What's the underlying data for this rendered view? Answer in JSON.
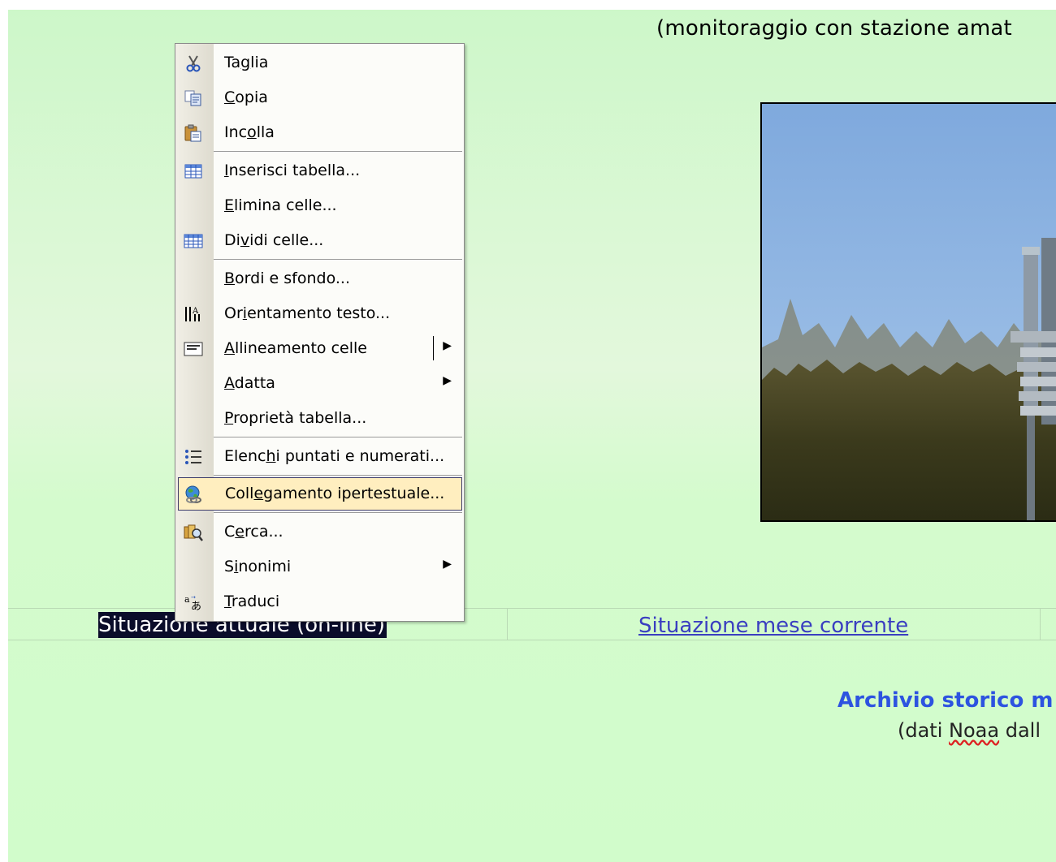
{
  "page": {
    "title_text": "(monitoraggio con stazione amat",
    "table_cells": {
      "current_situation": "Situazione attuale (on-line)",
      "current_month_link": "Situazione mese corrente"
    },
    "archive_heading": "Archivio storico m",
    "archive_sub_prefix": "(dati ",
    "archive_sub_noaa": "Noaa",
    "archive_sub_suffix": " dall",
    "colors": {
      "background": "#d1fccb",
      "link": "#3a3ec0",
      "archive_heading": "#2d53e0",
      "selection": "#0a0c2a"
    }
  },
  "context_menu": {
    "items": [
      {
        "pre": "Ta",
        "u": "g",
        "post": "lia",
        "icon": "scissors-icon",
        "submenu": false
      },
      {
        "pre": "",
        "u": "C",
        "post": "opia",
        "icon": "copy-icon",
        "submenu": false
      },
      {
        "pre": "Inc",
        "u": "o",
        "post": "lla",
        "icon": "paste-icon",
        "submenu": false
      },
      {
        "pre": "",
        "u": "I",
        "post": "nserisci tabella...",
        "icon": "insert-table-icon",
        "submenu": false
      },
      {
        "pre": "",
        "u": "E",
        "post": "limina celle...",
        "icon": "",
        "submenu": false
      },
      {
        "pre": "Di",
        "u": "v",
        "post": "idi celle...",
        "icon": "split-cells-icon",
        "submenu": false
      },
      {
        "pre": "",
        "u": "B",
        "post": "ordi e sfondo...",
        "icon": "",
        "submenu": false
      },
      {
        "pre": "Or",
        "u": "i",
        "post": "entamento testo...",
        "icon": "text-direction-icon",
        "submenu": false
      },
      {
        "pre": "",
        "u": "A",
        "post": "llineamento celle",
        "icon": "cell-alignment-icon",
        "submenu": true
      },
      {
        "pre": "",
        "u": "A",
        "post": "datta",
        "icon": "",
        "submenu": true
      },
      {
        "pre": "",
        "u": "P",
        "post": "roprietà tabella...",
        "icon": "",
        "submenu": false
      },
      {
        "pre": "Elenc",
        "u": "h",
        "post": "i puntati e numerati...",
        "icon": "bullets-icon",
        "submenu": false
      },
      {
        "pre": "Coll",
        "u": "e",
        "post": "gamento ipertestuale...",
        "icon": "hyperlink-globe-icon",
        "submenu": false
      },
      {
        "pre": "C",
        "u": "e",
        "post": "rca...",
        "icon": "research-icon",
        "submenu": false
      },
      {
        "pre": "S",
        "u": "i",
        "post": "nonimi",
        "icon": "",
        "submenu": true
      },
      {
        "pre": "",
        "u": "T",
        "post": "raduci",
        "icon": "translate-icon",
        "submenu": false
      }
    ]
  }
}
